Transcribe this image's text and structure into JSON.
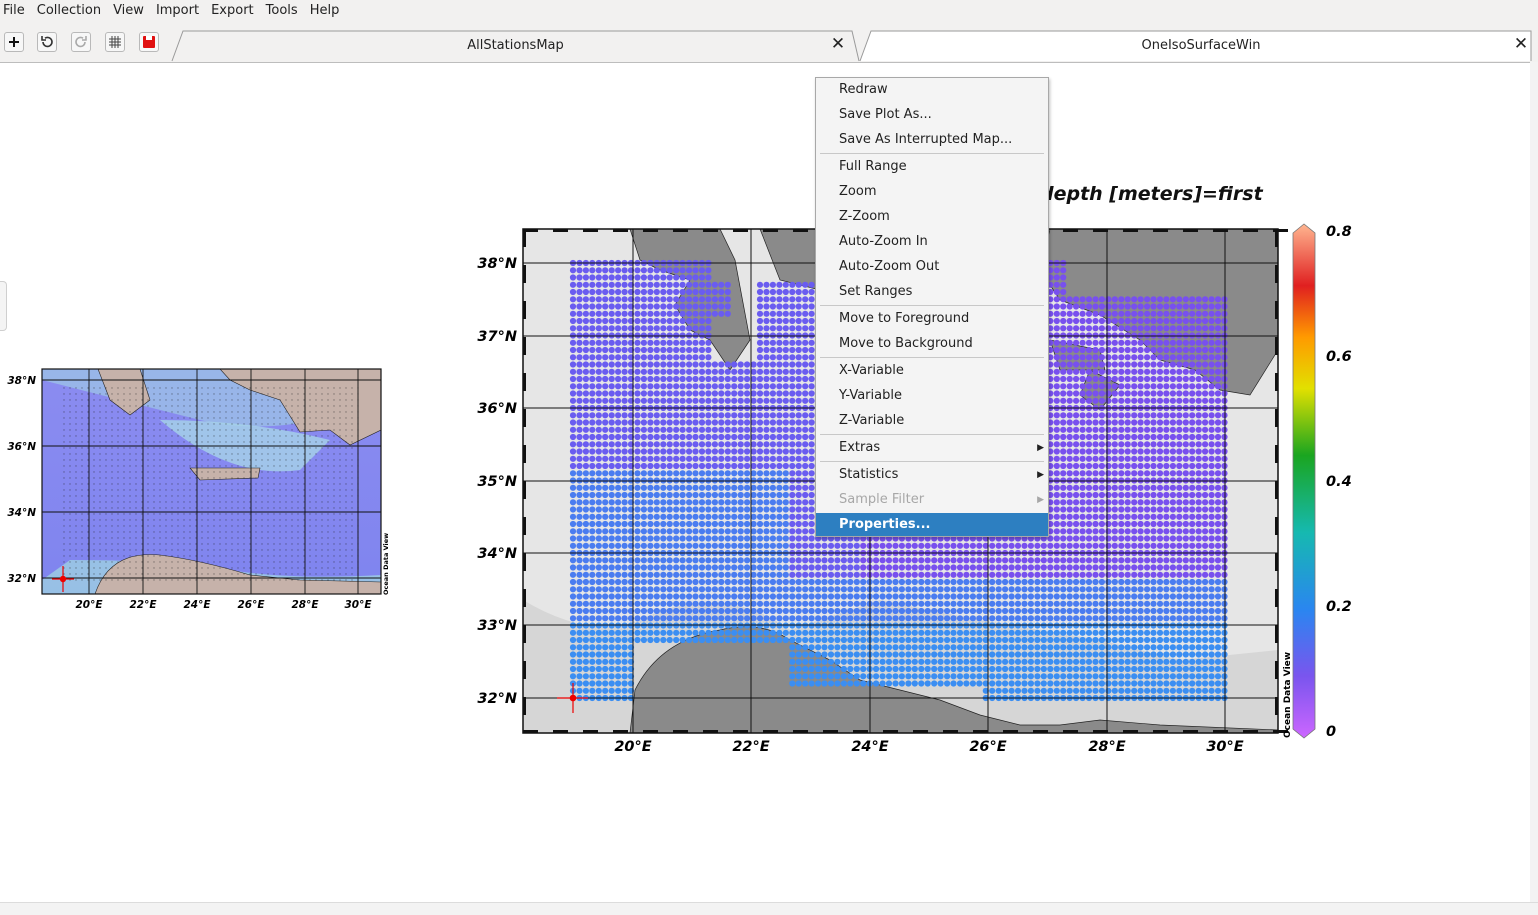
{
  "menubar": {
    "items": [
      "File",
      "Collection",
      "View",
      "Import",
      "Export",
      "Tools",
      "Help"
    ]
  },
  "toolbar": {
    "icons": [
      "plus-icon",
      "undo-icon",
      "redo-icon",
      "grid-icon",
      "save-red-icon"
    ]
  },
  "tabs": [
    {
      "label": "AllStationsMap"
    },
    {
      "label": "OneIsoSurfaceWin"
    }
  ],
  "main_plot": {
    "title_visible": "depth [meters]=first",
    "lat_labels": [
      "38°N",
      "37°N",
      "36°N",
      "35°N",
      "34°N",
      "33°N",
      "32°N"
    ],
    "lon_labels": [
      "20°E",
      "22°E",
      "24°E",
      "26°E",
      "28°E",
      "30°E"
    ],
    "watermark": "Ocean Data View",
    "colorbar_labels": [
      "0.8",
      "0.6",
      "0.4",
      "0.2",
      "0"
    ]
  },
  "mini_map": {
    "lat_labels": [
      "38°N",
      "36°N",
      "34°N",
      "32°N"
    ],
    "lon_labels": [
      "20°E",
      "22°E",
      "24°E",
      "26°E",
      "28°E",
      "30°E"
    ],
    "watermark": "Ocean Data View"
  },
  "context_menu": {
    "items": [
      {
        "label": "Redraw"
      },
      {
        "label": "Save Plot As..."
      },
      {
        "label": "Save As Interrupted Map..."
      },
      {
        "label": "Full Range"
      },
      {
        "label": "Zoom"
      },
      {
        "label": "Z-Zoom"
      },
      {
        "label": "Auto-Zoom In"
      },
      {
        "label": "Auto-Zoom Out"
      },
      {
        "label": "Set Ranges"
      },
      {
        "label": "Move to Foreground"
      },
      {
        "label": "Move to Background"
      },
      {
        "label": "X-Variable"
      },
      {
        "label": "Y-Variable"
      },
      {
        "label": "Z-Variable"
      },
      {
        "label": "Extras"
      },
      {
        "label": "Statistics"
      },
      {
        "label": "Sample Filter"
      },
      {
        "label": "Properties..."
      }
    ]
  },
  "colors": {
    "accent": "#2d7fc1",
    "land": "#8a8a8a",
    "ocean": "#e6e6e6",
    "station_main": "#7a55ee",
    "station_south": "#2a86f0"
  }
}
